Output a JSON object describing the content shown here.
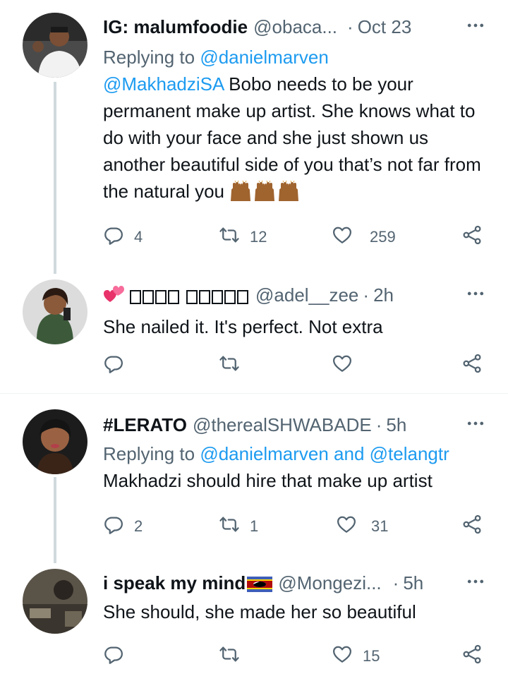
{
  "colors": {
    "accent": "#1d9bf0",
    "muted": "#536471",
    "text": "#0f1419",
    "line": "#cfd9de"
  },
  "tweets": [
    {
      "name": "IG: malumfoodie",
      "handle": "@obaca...",
      "time": "Oct 23",
      "replying_prefix": "Replying to ",
      "replying_to": "@danielmarven",
      "mention": "@MakhadziSA",
      "text": " Bobo needs to be your permanent make up artist. She knows what to do with your face and she just shown us another beautiful side of you that’s not far from the natural you",
      "emoji": "raising-hands-emoji",
      "replies": "4",
      "retweets": "12",
      "likes": "259"
    },
    {
      "name_emoji": "heart-emoji",
      "name_boxes": "unrendered-glyphs",
      "handle": "@adel__zee",
      "time": "2h",
      "text": "She nailed it. It's perfect. Not extra",
      "replies": "",
      "retweets": "",
      "likes": ""
    },
    {
      "name": "#LERATO",
      "handle": "@therealSHWABADE",
      "time": "5h",
      "replying_prefix": "Replying to ",
      "replying_to": "@danielmarven",
      "replying_and": " and ",
      "replying_to2": "@telangtr",
      "text": "Makhadzi should hire that make up artist",
      "replies": "2",
      "retweets": "1",
      "likes": "31"
    },
    {
      "name": "i speak my mind",
      "name_emoji": "eswatini-flag",
      "handle": "@Mongezi...",
      "time": "5h",
      "text": "She should, she made her so beautiful",
      "replies": "",
      "retweets": "",
      "likes": "15"
    }
  ],
  "sep": "·"
}
